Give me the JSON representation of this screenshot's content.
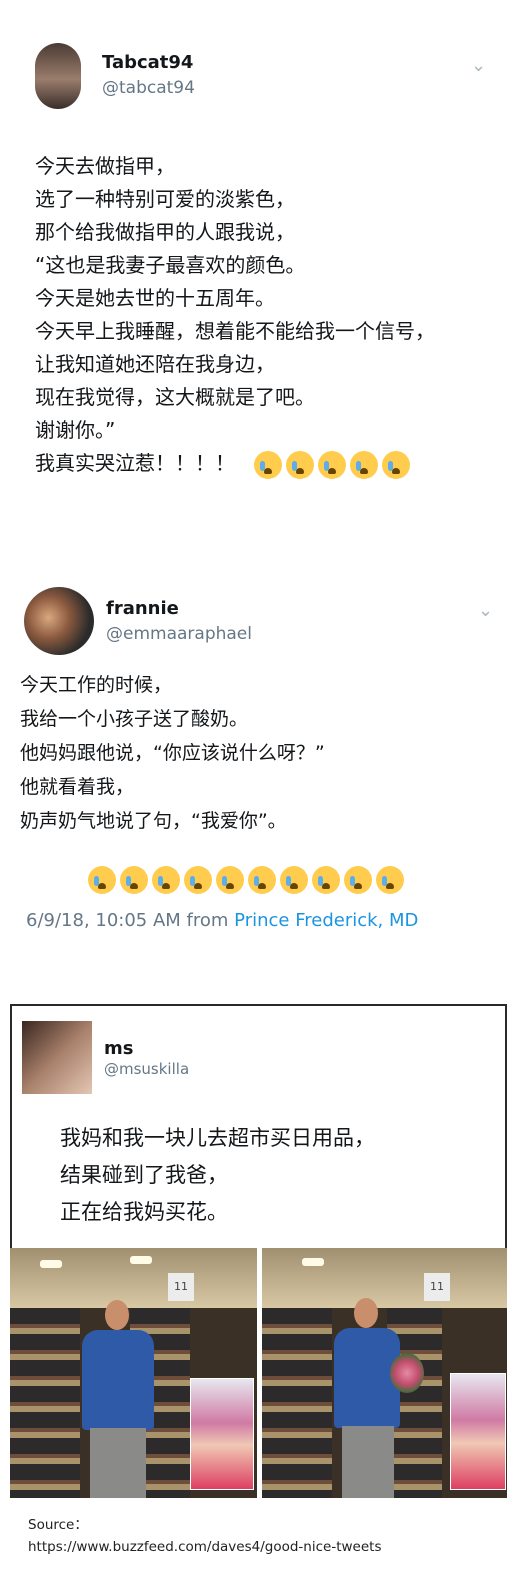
{
  "tweets": [
    {
      "display_name": "Tabcat94",
      "handle": "@tabcat94",
      "lines": [
        "今天去做指甲，",
        "选了一种特别可爱的淡紫色，",
        "那个给我做指甲的人跟我说，",
        "“这也是我妻子最喜欢的颜色。",
        "今天是她去世的十五周年。",
        "今天早上我睡醒，想着能不能给我一个信号，",
        "让我知道她还陪在我身边，",
        "现在我觉得，这大概就是了吧。",
        "谢谢你。”",
        "我真实哭泣惹！！！！"
      ],
      "emoji_count": 5,
      "emoji_icon": "loudly-crying-face"
    },
    {
      "display_name": "frannie",
      "handle": "@emmaaraphael",
      "lines": [
        "今天工作的时候，",
        "我给一个小孩子送了酸奶。",
        "他妈妈跟他说，“你应该说什么呀？”",
        "他就看着我，",
        "奶声奶气地说了句，“我爱你”。"
      ],
      "emoji_count": 10,
      "emoji_icon": "loudly-crying-face",
      "timestamp": "6/9/18, 10:05 AM from",
      "location": "Prince Frederick, MD"
    },
    {
      "display_name": "ms",
      "handle": "@msuskilla",
      "lines": [
        "我妈和我一块儿去超市买日用品，",
        "结果碰到了我爸，",
        "正在给我妈买花。"
      ]
    }
  ],
  "source": {
    "label": "Source：",
    "url": "https://www.buzzfeed.com/daves4/good-nice-tweets"
  },
  "colors": {
    "handle": "#657786",
    "link": "#1b95e0"
  }
}
